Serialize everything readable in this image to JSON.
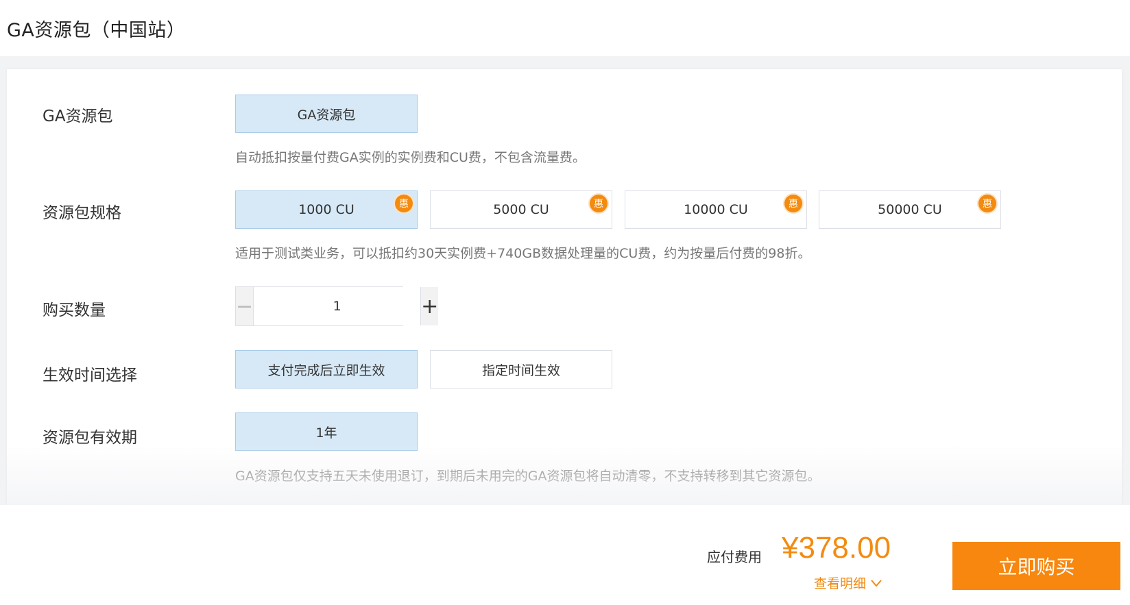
{
  "page": {
    "title": "GA资源包（中国站）"
  },
  "rows": {
    "package": {
      "label": "GA资源包",
      "options": [
        {
          "label": "GA资源包",
          "selected": true
        }
      ],
      "description": "自动抵扣按量付费GA实例的实例费和CU费，不包含流量费。"
    },
    "spec": {
      "label": "资源包规格",
      "options": [
        {
          "label": "1000 CU",
          "badge": "惠",
          "selected": true
        },
        {
          "label": "5000 CU",
          "badge": "惠",
          "selected": false
        },
        {
          "label": "10000 CU",
          "badge": "惠",
          "selected": false
        },
        {
          "label": "50000 CU",
          "badge": "惠",
          "selected": false
        }
      ],
      "description": "适用于测试类业务，可以抵扣约30天实例费+740GB数据处理量的CU费，约为按量后付费的98折。"
    },
    "quantity": {
      "label": "购买数量",
      "value": "1",
      "minus": "−",
      "plus": "+"
    },
    "effective": {
      "label": "生效时间选择",
      "options": [
        {
          "label": "支付完成后立即生效",
          "selected": true
        },
        {
          "label": "指定时间生效",
          "selected": false
        }
      ]
    },
    "validity": {
      "label": "资源包有效期",
      "options": [
        {
          "label": "1年",
          "selected": true
        }
      ],
      "description": "GA资源包仅支持五天未使用退订，到期后未用完的GA资源包将自动清零，不支持转移到其它资源包。"
    }
  },
  "footer": {
    "fee_label": "应付费用",
    "price": "¥378.00",
    "detail_label": "查看明细",
    "buy_label": "立即购买"
  },
  "colors": {
    "accent": "#f38b10",
    "selected_bg": "#d7e9f7",
    "buy_button": "#f7870e"
  },
  "icons": {
    "detail": "chevron-down-icon"
  }
}
